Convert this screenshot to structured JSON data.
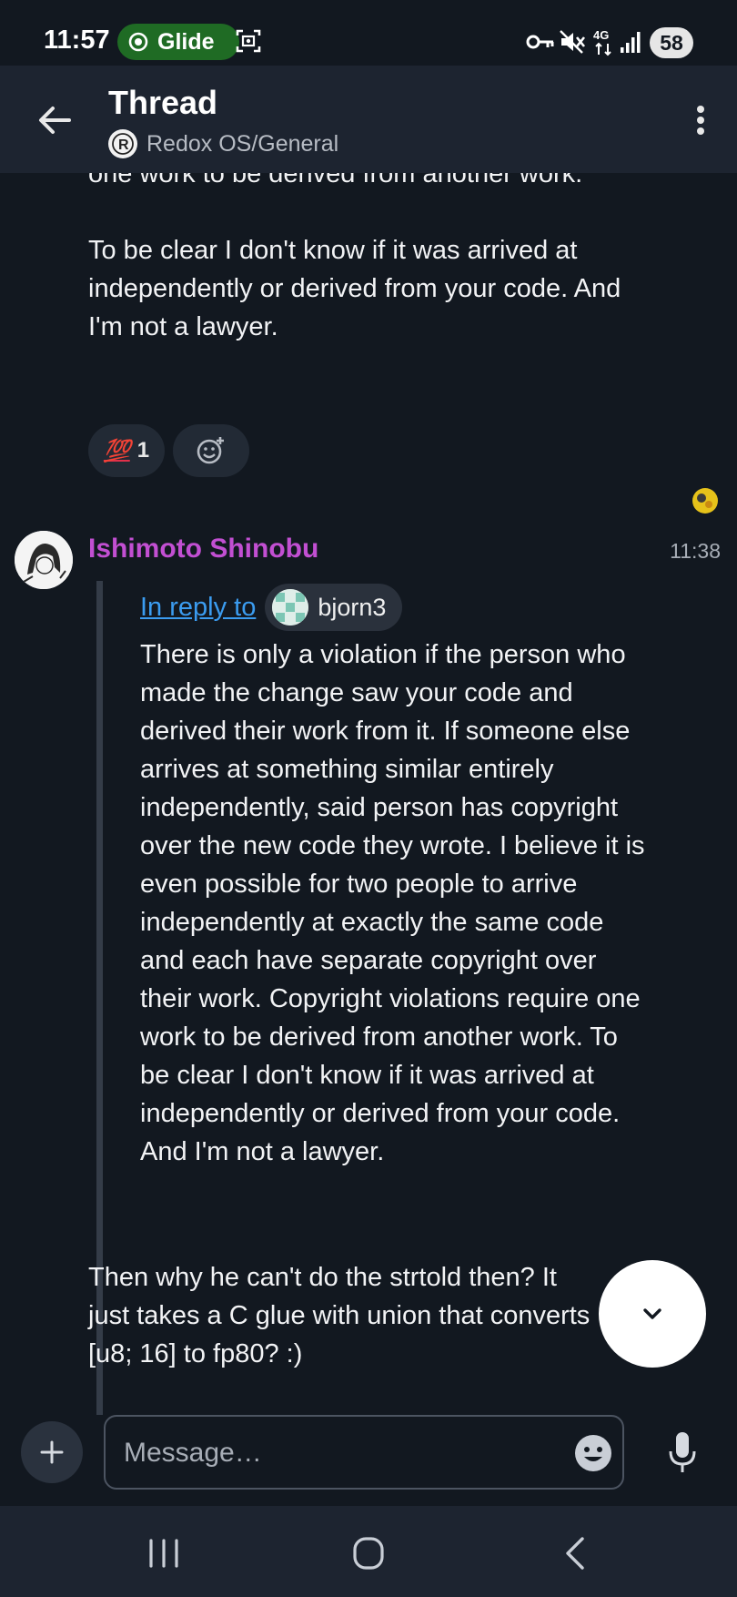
{
  "status_bar": {
    "time": "11:57",
    "glide_label": "Glide",
    "battery": "58",
    "icons": [
      "record-icon",
      "screenshot-icon",
      "vpn-key-icon",
      "mute-icon",
      "network-4g-icon",
      "signal-icon",
      "battery-icon"
    ]
  },
  "header": {
    "title": "Thread",
    "room": "Redox OS/General",
    "icons": [
      "back-arrow-icon",
      "room-avatar-icon",
      "more-vert-icon"
    ]
  },
  "timeline": {
    "earlier_message": {
      "partial_line": "one work to be derived from another work.",
      "paragraph": "To be clear I don't know if it was arrived at independently or derived from your code. And I'm not a lawyer.",
      "reaction": {
        "emoji": "💯",
        "count": "1"
      },
      "add_reaction_icon": "add-reaction-icon"
    },
    "message": {
      "sender": "Ishimoto Shinobu",
      "time": "11:38",
      "reply": {
        "link_text": "In reply to",
        "user": "bjorn3",
        "body": "There is only a violation if the person who made the change saw your code and derived their work from it. If someone else arrives at something similar entirely independently, said person has copyright over the new code they wrote. I believe it is even possible for two people to arrive independently at exactly the same code and each have separate copyright over their work. Copyright violations require one work to be derived from another work. To be clear I don't know if it was arrived at independently or derived from your code. And I'm not a lawyer."
      },
      "body": "Then why he can't do the strtold then? It just takes a C glue with union that converts [u8; 16] to fp80? :)"
    }
  },
  "composer": {
    "placeholder": "Message…",
    "value": ""
  },
  "colors": {
    "background": "#121820",
    "header": "#1d2430",
    "sender_name": "#c24fd2",
    "link": "#3b9cf0",
    "glide_pill": "#1f6b24",
    "reaction_emoji": "#e0304a"
  }
}
